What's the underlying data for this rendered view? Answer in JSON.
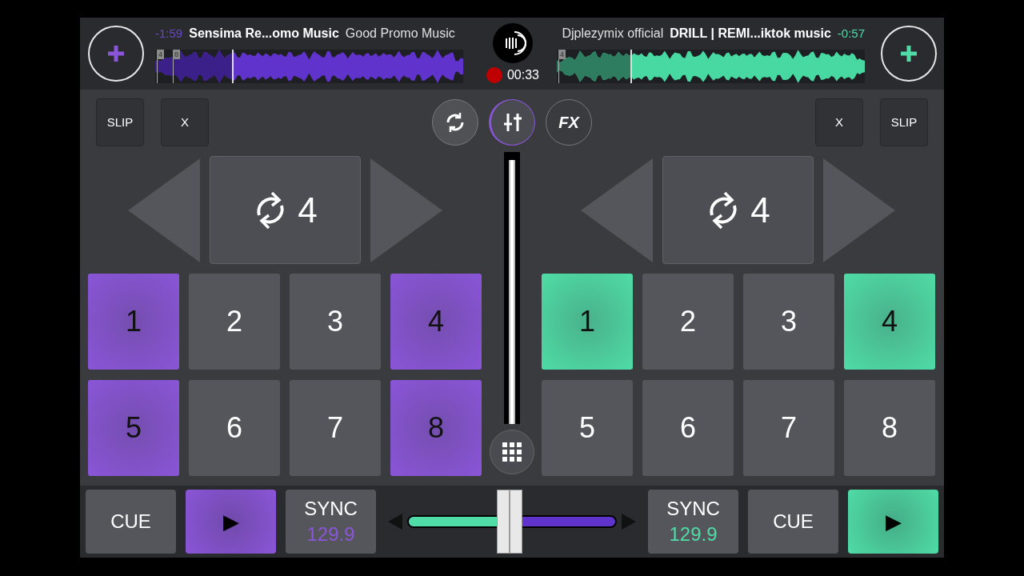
{
  "decks": [
    {
      "color": "#8a55d8",
      "time": "-1:59",
      "title": "Sensima Re...omo Music",
      "artist": "Good Promo Music",
      "markers": [
        "4",
        "8"
      ],
      "level": 0.25,
      "buttons": [
        "SLIP",
        "X"
      ],
      "loop": "4",
      "pads": [
        {
          "label": "1",
          "on": true
        },
        {
          "label": "2",
          "on": false
        },
        {
          "label": "3",
          "on": false
        },
        {
          "label": "4",
          "on": true
        },
        {
          "label": "5",
          "on": true
        },
        {
          "label": "6",
          "on": false
        },
        {
          "label": "7",
          "on": false
        },
        {
          "label": "8",
          "on": true
        }
      ],
      "cue": "CUE",
      "play": "▶",
      "playing": true,
      "sync": "SYNC",
      "bpm": "129.9"
    },
    {
      "color": "#4fdca6",
      "time": "-0:57",
      "title": "DRILL | REMI...iktok music",
      "artist": "Djplezymix official",
      "markers": [
        "4"
      ],
      "level": 0.24,
      "buttons": [
        "X",
        "SLIP"
      ],
      "loop": "4",
      "pads": [
        {
          "label": "1",
          "on": true
        },
        {
          "label": "2",
          "on": false
        },
        {
          "label": "3",
          "on": false
        },
        {
          "label": "4",
          "on": true
        },
        {
          "label": "5",
          "on": false
        },
        {
          "label": "6",
          "on": false
        },
        {
          "label": "7",
          "on": false
        },
        {
          "label": "8",
          "on": false
        }
      ],
      "cue": "CUE",
      "play": "▶",
      "playing": true,
      "sync": "SYNC",
      "bpm": "129.9"
    }
  ],
  "center": {
    "recording": true,
    "record_time": "00:33",
    "tools": [
      {
        "kind": "sync",
        "selected": false
      },
      {
        "kind": "mixer",
        "selected": true
      },
      {
        "kind": "fx",
        "label": "FX",
        "selected": false
      }
    ],
    "volume": {
      "level": 0.97
    },
    "crossfader": {
      "level": 0.49
    }
  }
}
